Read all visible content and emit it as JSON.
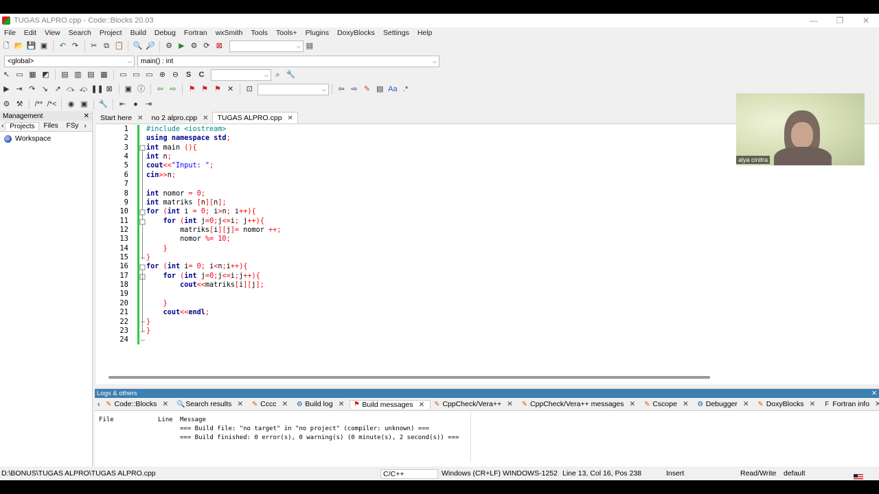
{
  "window": {
    "title": "TUGAS ALPRO.cpp - Code::Blocks 20.03",
    "controls": [
      "—",
      "❐",
      "✕"
    ]
  },
  "menu": [
    "File",
    "Edit",
    "View",
    "Search",
    "Project",
    "Build",
    "Debug",
    "Fortran",
    "wxSmith",
    "Tools",
    "Tools+",
    "Plugins",
    "DoxyBlocks",
    "Settings",
    "Help"
  ],
  "scope": {
    "global": "<global>",
    "function": "main() : int"
  },
  "management": {
    "title": "Management",
    "tabs": [
      "Projects",
      "Files",
      "FSy"
    ],
    "workspace": "Workspace"
  },
  "editor_tabs": [
    {
      "label": "Start here"
    },
    {
      "label": "no 2 alpro.cpp"
    },
    {
      "label": "TUGAS ALPRO.cpp"
    }
  ],
  "code": {
    "line_numbers": [
      "1",
      "2",
      "3",
      "4",
      "5",
      "6",
      "7",
      "8",
      "9",
      "10",
      "11",
      "12",
      "13",
      "14",
      "15",
      "16",
      "17",
      "18",
      "19",
      "20",
      "21",
      "22",
      "23",
      "24"
    ],
    "lines": [
      "#include <iostream>",
      "using namespace std;",
      "int main (){",
      "int n;",
      "cout<<\"Input: \";",
      "cin>>n;",
      "",
      "int nomor = 0;",
      "int matriks [n][n];",
      "for (int i = 0; i>n; i++){",
      "    for (int j=0;j<=i; j++){",
      "        matriks[i][j]= nomor ++;",
      "        nomor %= 10;",
      "    }",
      "}",
      "for (int i= 0; i<n;i++){",
      "    for (int j=0;j<=i;j++){",
      "        cout<<matriks[i][j];",
      "",
      "    }",
      "    cout<<endl;",
      "}",
      "}",
      ""
    ]
  },
  "logs": {
    "title": "Logs & others",
    "tabs": [
      {
        "label": "Code::Blocks",
        "icon": "pencil-icon"
      },
      {
        "label": "Search results",
        "icon": "magnifier-icon"
      },
      {
        "label": "Cccc",
        "icon": "pencil-icon"
      },
      {
        "label": "Build log",
        "icon": "gear-icon"
      },
      {
        "label": "Build messages",
        "icon": "build-icon"
      },
      {
        "label": "CppCheck/Vera++",
        "icon": "pencil-icon"
      },
      {
        "label": "CppCheck/Vera++ messages",
        "icon": "pencil-icon"
      },
      {
        "label": "Cscope",
        "icon": "pencil-icon"
      },
      {
        "label": "Debugger",
        "icon": "gear-icon"
      },
      {
        "label": "DoxyBlocks",
        "icon": "pencil-icon"
      },
      {
        "label": "Fortran info",
        "icon": "fortran-icon"
      },
      {
        "label": "Close",
        "icon": "close-icon"
      }
    ],
    "columns": [
      "File",
      "Line",
      "Message"
    ],
    "rows": [
      {
        "file": "",
        "line": "",
        "message": "=== Build file: \"no target\" in \"no project\" (compiler: unknown) ==="
      },
      {
        "file": "",
        "line": "",
        "message": "=== Build finished: 0 error(s), 0 warning(s) (0 minute(s), 2 second(s)) ==="
      }
    ]
  },
  "status": {
    "path": "D:\\BONUS\\TUGAS ALPRO\\TUGAS ALPRO.cpp",
    "language": "C/C++",
    "eol": "Windows (CR+LF)",
    "encoding": "WINDOWS-1252",
    "position": "Line 13, Col 16, Pos 238",
    "mode": "Insert",
    "access": "Read/Write",
    "profile": "default"
  },
  "webcam": {
    "name": "alya cinitra"
  },
  "colors": {
    "logs_header": "#3c7fb1",
    "change_bar": "#2ecc40",
    "keyword": "#00008b",
    "string": "#0000ff",
    "number": "#f0002a"
  }
}
